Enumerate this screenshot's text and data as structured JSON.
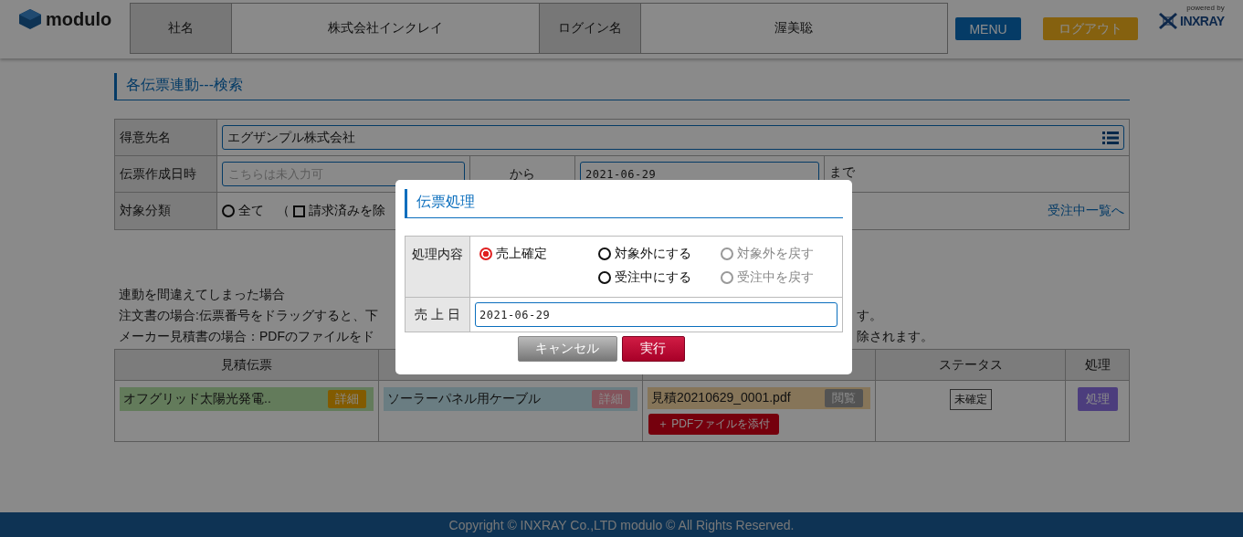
{
  "header": {
    "logo": "modulo",
    "info": [
      {
        "kind": "label",
        "text": "社名"
      },
      {
        "kind": "value",
        "text": "株式会社インクレイ"
      },
      {
        "kind": "label",
        "text": "ログイン名"
      },
      {
        "kind": "value",
        "text": "渥美聡"
      }
    ],
    "buttons": [
      {
        "label": "MENU",
        "kind": "menu"
      },
      {
        "label": "ログアウト",
        "kind": "logout"
      }
    ],
    "powered": "powered by",
    "brand": "INXRAY"
  },
  "page_title": "各伝票連動---検索",
  "search": {
    "customer": {
      "label": "得意先名",
      "value": "エグザンプル株式会社"
    },
    "date": {
      "label": "伝票作成日時",
      "placeholder": "こちらは未入力可",
      "from": "から",
      "to_value": "2021-06-29",
      "to": "まで"
    },
    "category": {
      "label": "対象分類",
      "radio": {
        "label": "全て",
        "selected": false
      },
      "paren": "（",
      "checkbox": {
        "label": "請求済みを除",
        "checked": false
      },
      "link": "受注中一覧へ"
    }
  },
  "notes": [
    {
      "left": "連動を間違えてしまった場合"
    },
    {
      "left": "注文書の場合:伝票番号をドラッグすると、下",
      "right": "す。"
    },
    {
      "left": "メーカー見積書の場合：PDFのファイルをド",
      "right": "除されます。"
    }
  ],
  "results": {
    "columns": [
      "見積伝票",
      "",
      "",
      "ステータス",
      "処理"
    ],
    "rows": [
      {
        "estimate": {
          "label": "オフグリッド太陽光発電..",
          "button": "詳細"
        },
        "order": {
          "label": "ソーラーパネル用ケーブル",
          "button": "詳細"
        },
        "maker": {
          "label": "見積20210629_0001.pdf",
          "button": "閲覧",
          "attach": "＋ PDFファイルを添付"
        },
        "status": "未確定",
        "action": "処理"
      }
    ]
  },
  "dialog": {
    "title": "伝票処理",
    "process_label": "処理内容",
    "options": [
      {
        "label": "売上確定",
        "selected": true,
        "disabled": false
      },
      {
        "label": "対象外にする",
        "selected": false,
        "disabled": false
      },
      {
        "label": "受注中にする",
        "selected": false,
        "disabled": false
      },
      {
        "label": "対象外を戻す",
        "selected": false,
        "disabled": true
      },
      {
        "label": "受注中を戻す",
        "selected": false,
        "disabled": true
      }
    ],
    "date_label": "売 上 日",
    "date_value": "2021-06-29",
    "buttons": [
      {
        "label": "キャンセル",
        "kind": "secondary"
      },
      {
        "label": "実行",
        "kind": "primary"
      }
    ]
  },
  "footer": "Copyright © INXRAY Co.,LTD modulo © All Rights Reserved."
}
